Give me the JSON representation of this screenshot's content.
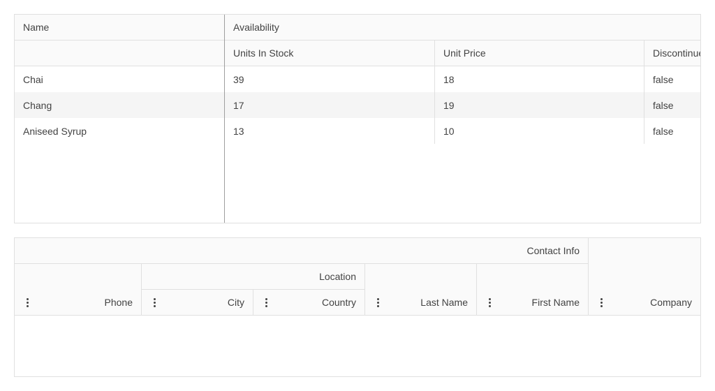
{
  "grid1": {
    "group_headers": {
      "name": "Name",
      "availability": "Availability"
    },
    "columns": {
      "units_in_stock": "Units In Stock",
      "unit_price": "Unit Price",
      "discontinued": "Discontinued"
    },
    "rows": [
      {
        "name": "Chai",
        "units_in_stock": "39",
        "unit_price": "18",
        "discontinued": "false"
      },
      {
        "name": "Chang",
        "units_in_stock": "17",
        "unit_price": "19",
        "discontinued": "false"
      },
      {
        "name": "Aniseed Syrup",
        "units_in_stock": "13",
        "unit_price": "10",
        "discontinued": "false"
      }
    ]
  },
  "grid2": {
    "group_headers": {
      "contact_info": "Contact Info",
      "location": "Location"
    },
    "columns": {
      "phone": "Phone",
      "city": "City",
      "country": "Country",
      "last_name": "Last Name",
      "first_name": "First Name",
      "company": "Company"
    },
    "column_menu_icon": "kebab-menu-icon"
  },
  "colors": {
    "header_bg": "#fafafa",
    "border": "#e0e0e0",
    "alt_row_bg": "#f5f5f5",
    "text": "#424242"
  }
}
